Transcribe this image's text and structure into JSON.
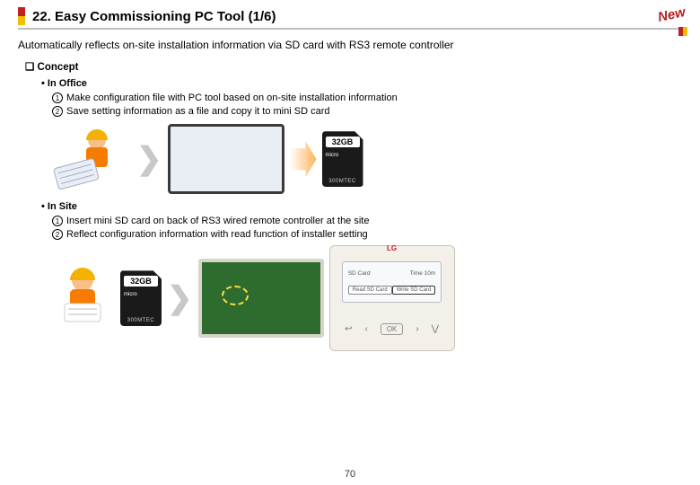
{
  "header": {
    "title": "22. Easy Commissioning PC Tool (1/6)",
    "badge": "New"
  },
  "subtitle": "Automatically reflects on-site installation information via SD card with RS3 remote controller",
  "concept": {
    "heading": "Concept",
    "office": {
      "label": "In Office",
      "step1": "Make configuration file with PC tool based on on-site installation information",
      "step2": "Save setting information as a file and copy it to mini SD card",
      "sd_capacity": "32GB",
      "sd_micro": "micro",
      "sd_brand": "300MTEC"
    },
    "site": {
      "label": "In Site",
      "step1": "Insert mini SD card on back of RS3 wired remote controller at the site",
      "step2": "Reflect configuration information with read function of installer setting",
      "sd_capacity": "32GB",
      "sd_micro": "micro",
      "sd_brand": "300MTEC",
      "remote": {
        "brand": "LG",
        "hdr_left": "SD Card",
        "hdr_right": "Time 10m",
        "btn_read": "Read SD Card",
        "btn_write": "Write SD Card",
        "ok": "OK"
      }
    }
  },
  "page_number": "70"
}
